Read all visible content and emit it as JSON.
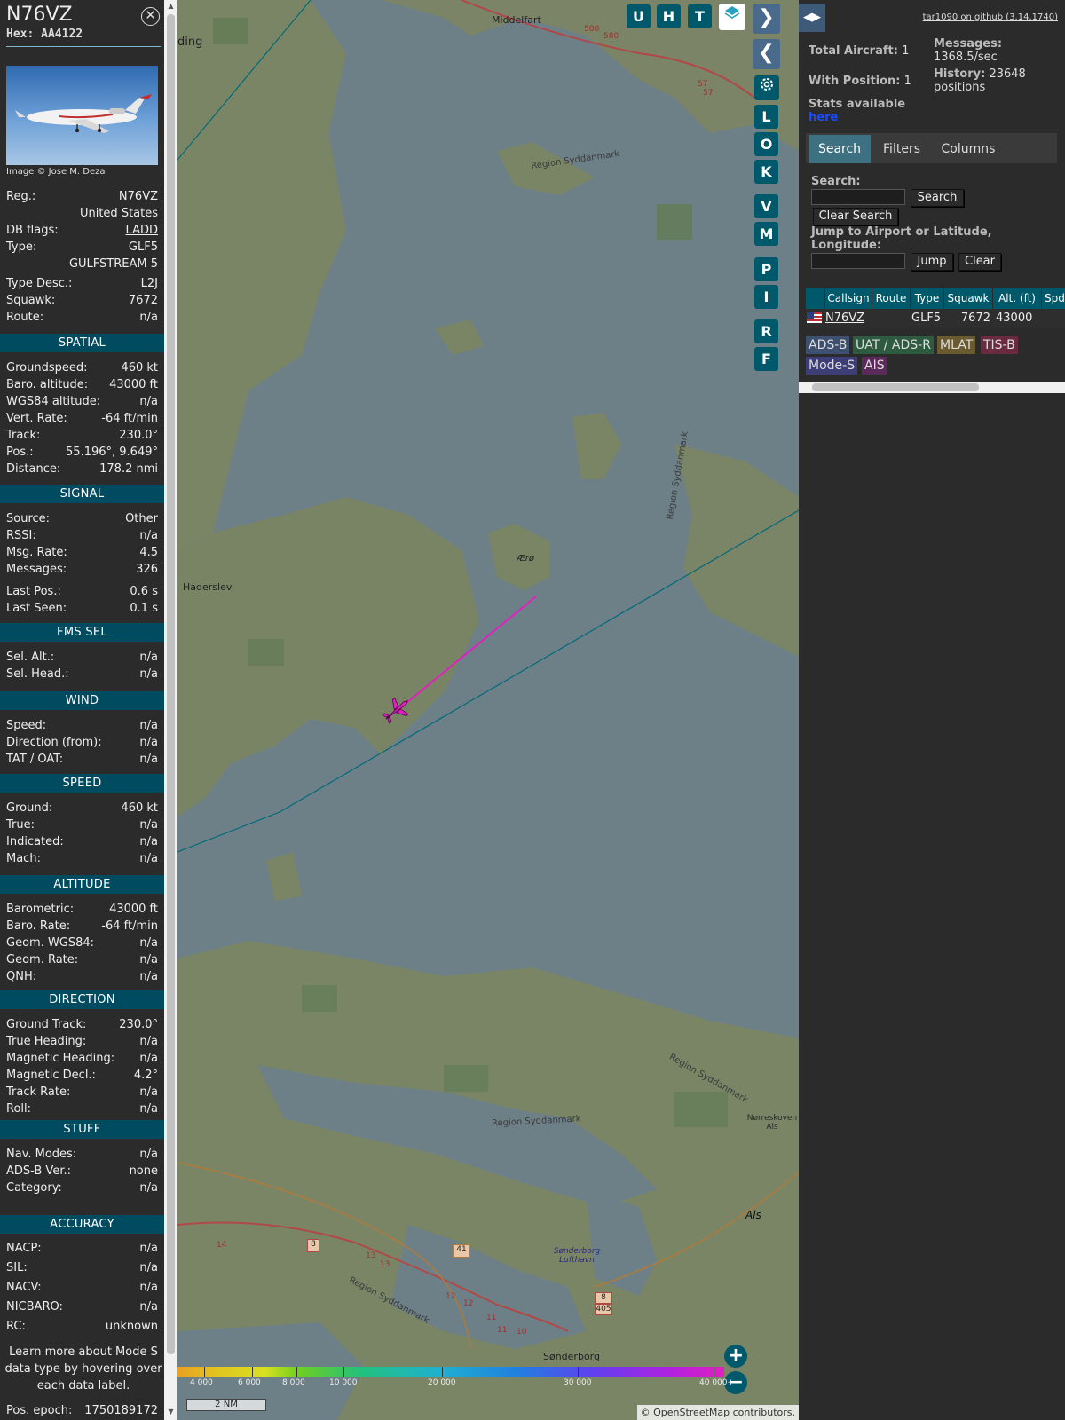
{
  "aircraft": {
    "title": "N76VZ",
    "hex": "Hex: AA4122",
    "close_icon": "close-circle-icon"
  },
  "photo": {
    "credit": "Image © Jose M. Deza"
  },
  "info": [
    {
      "k": "Reg.:",
      "v": "N76VZ",
      "u": true
    },
    {
      "k": "",
      "v": "United States"
    },
    {
      "k": "DB flags:",
      "v": "LADD",
      "u": true
    },
    {
      "k": "Type:",
      "v": "GLF5"
    },
    {
      "k": "",
      "v": "GULFSTREAM 5"
    },
    {
      "k": "Type Desc.:",
      "v": "L2J"
    },
    {
      "k": "Squawk:",
      "v": "7672"
    },
    {
      "k": "Route:",
      "v": "n/a"
    }
  ],
  "sections": [
    {
      "title": "SPATIAL",
      "rows": [
        {
          "k": "Groundspeed:",
          "v": "460 kt"
        },
        {
          "k": "Baro. altitude:",
          "v": "43000 ft"
        },
        {
          "k": "WGS84 altitude:",
          "v": "n/a"
        },
        {
          "k": "Vert. Rate:",
          "v": "-64 ft/min"
        },
        {
          "k": "Track:",
          "v": "230.0°"
        },
        {
          "k": "Pos.:",
          "v": "55.196°, 9.649°"
        },
        {
          "k": "Distance:",
          "v": "178.2 nmi"
        }
      ]
    },
    {
      "title": "SIGNAL",
      "rows": [
        {
          "k": "Source:",
          "v": "Other"
        },
        {
          "k": "RSSI:",
          "v": "n/a"
        },
        {
          "k": "Msg. Rate:",
          "v": "4.5"
        },
        {
          "k": "Messages:",
          "v": "326"
        },
        {
          "k": "Last Pos.:",
          "v": "0.6 s"
        },
        {
          "k": "Last Seen:",
          "v": "0.1 s"
        }
      ]
    },
    {
      "title": "FMS SEL",
      "rows": [
        {
          "k": "Sel. Alt.:",
          "v": "n/a"
        },
        {
          "k": "Sel. Head.:",
          "v": "n/a"
        }
      ]
    },
    {
      "title": "WIND",
      "rows": [
        {
          "k": "Speed:",
          "v": "n/a"
        },
        {
          "k": "Direction (from):",
          "v": "n/a"
        },
        {
          "k": "TAT / OAT:",
          "v": "n/a"
        }
      ]
    },
    {
      "title": "SPEED",
      "rows": [
        {
          "k": "Ground:",
          "v": "460 kt"
        },
        {
          "k": "True:",
          "v": "n/a"
        },
        {
          "k": "Indicated:",
          "v": "n/a"
        },
        {
          "k": "Mach:",
          "v": "n/a"
        }
      ]
    },
    {
      "title": "ALTITUDE",
      "rows": [
        {
          "k": "Barometric:",
          "v": "43000 ft"
        },
        {
          "k": "Baro. Rate:",
          "v": "-64 ft/min"
        },
        {
          "k": "Geom. WGS84:",
          "v": "n/a"
        },
        {
          "k": "Geom. Rate:",
          "v": "n/a"
        },
        {
          "k": "QNH:",
          "v": "n/a"
        }
      ]
    },
    {
      "title": "DIRECTION",
      "rows": [
        {
          "k": "Ground Track:",
          "v": "230.0°"
        },
        {
          "k": "True Heading:",
          "v": "n/a"
        },
        {
          "k": "Magnetic Heading:",
          "v": "n/a"
        },
        {
          "k": "Magnetic Decl.:",
          "v": "4.2°"
        },
        {
          "k": "Track Rate:",
          "v": "n/a"
        },
        {
          "k": "Roll:",
          "v": "n/a"
        }
      ]
    },
    {
      "title": "STUFF",
      "rows": [
        {
          "k": "Nav. Modes:",
          "v": "n/a"
        },
        {
          "k": "ADS-B Ver.:",
          "v": "none"
        },
        {
          "k": "Category:",
          "v": "n/a"
        }
      ]
    },
    {
      "title": "ACCURACY",
      "rows": [
        {
          "k": "NACP:",
          "v": "n/a"
        },
        {
          "k": "SIL:",
          "v": "n/a"
        },
        {
          "k": "NACV:",
          "v": "n/a"
        },
        {
          "k": "NICBARO:",
          "v": "n/a"
        },
        {
          "k": "RC:",
          "v": "unknown"
        }
      ]
    }
  ],
  "learn_more": "Learn more about Mode S data type by hovering over each data label.",
  "epoch": {
    "k": "Pos. epoch:",
    "v": "1750189172"
  },
  "map": {
    "places": [
      "Middelfart",
      "Haderslev",
      "Ærø",
      "Region Syddanmark",
      "Region Syddanmark",
      "Region Syddanmark",
      "Region Syddanmark",
      "Region Syddanmark",
      "Als",
      "Sønderborg",
      "Sønderborg Lufthavn",
      "Nørreskoven Als",
      "ding"
    ],
    "road_labels": [
      "580",
      "580",
      "57",
      "57",
      "8",
      "41",
      "8",
      "405",
      "14",
      "13",
      "13",
      "12",
      "12",
      "11",
      "11",
      "10"
    ],
    "scale": "2 NM",
    "attribution": "© OpenStreetMap contributors.",
    "alt_legend": [
      "4 000",
      "6 000",
      "8 000",
      "10 000",
      "20 000",
      "30 000",
      "40 000+"
    ],
    "buttons": {
      "u": "U",
      "h": "H",
      "t": "T",
      "l": "L",
      "o": "O",
      "k": "K",
      "v": "V",
      "m": "M",
      "p": "P",
      "i": "I",
      "r": "R",
      "f": "F"
    }
  },
  "panel": {
    "github": "tar1090 on github (3.14.1740)",
    "total_label": "Total Aircraft:",
    "total": "1",
    "withpos_label": "With Position:",
    "withpos": "1",
    "stats_label": "Stats available",
    "stats_link": "here",
    "messages_label": "Messages:",
    "messages": "1368.5/sec",
    "history_label": "History:",
    "history": "23648 positions",
    "tabs": [
      "Search",
      "Filters",
      "Columns"
    ],
    "search_label": "Search:",
    "search_button": "Search",
    "clear_search": "Clear Search",
    "jump_label": "Jump to Airport or Latitude, Longitude:",
    "jump_button": "Jump",
    "clear_button": "Clear",
    "columns": [
      "Callsign",
      "Route",
      "Type",
      "Squawk",
      "Alt. (ft)",
      "Spd."
    ],
    "row": {
      "callsign": "N76VZ",
      "route": "",
      "type": "GLF5",
      "squawk": "7672",
      "alt": "43000"
    },
    "badges": [
      "ADS-B",
      "UAT / ADS-R",
      "MLAT",
      "TIS-B",
      "Mode-S",
      "AIS"
    ]
  },
  "colors": {
    "accent": "#004b5f",
    "button": "#00596b",
    "track": "#e020c0",
    "plane": "#e020c0"
  }
}
